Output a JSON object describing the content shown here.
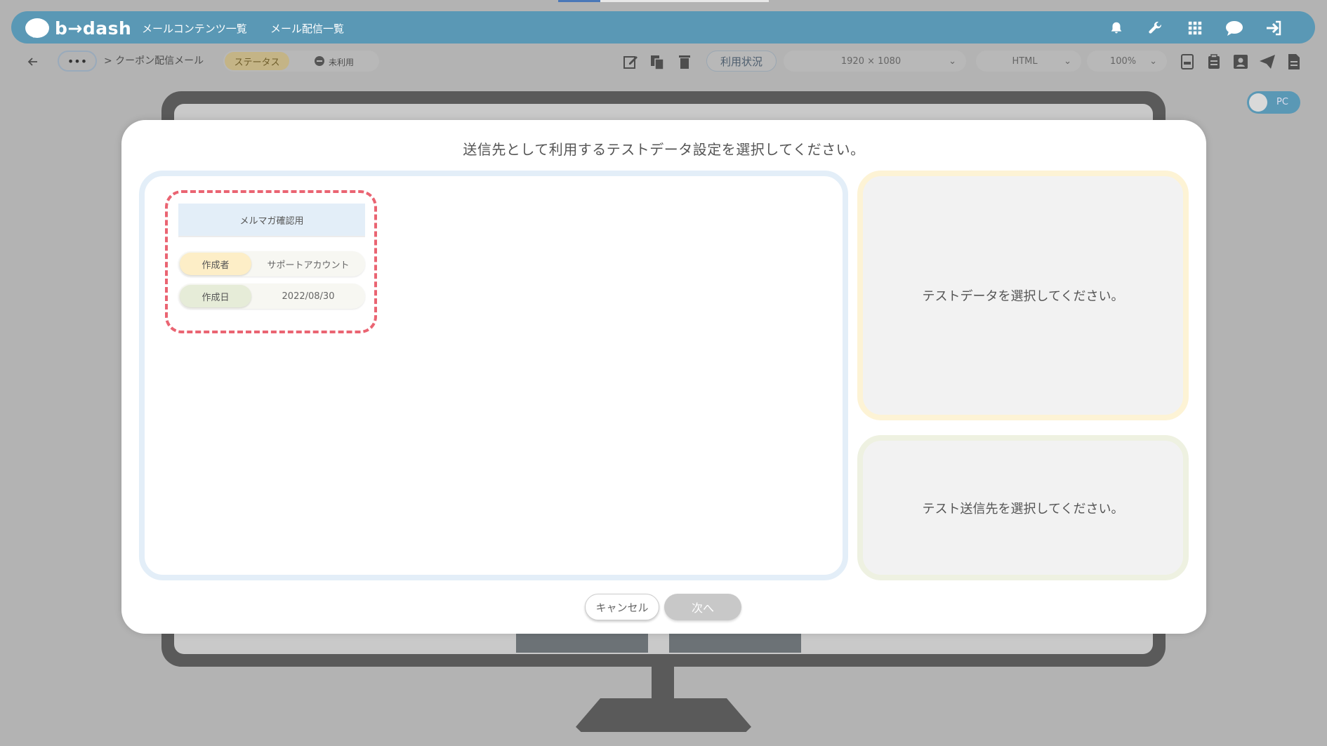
{
  "header": {
    "logo_text": "b→dash",
    "nav": [
      "メールコンテンツ一覧",
      "メール配信一覧"
    ],
    "icons": [
      "bell-icon",
      "wrench-icon",
      "grid-icon",
      "chat-icon",
      "logout-icon"
    ]
  },
  "toolbar": {
    "breadcrumb": "> クーポン配信メール",
    "status_label": "ステータス",
    "status_value": "未利用",
    "usage_button": "利用状況",
    "resolution": "1920 × 1080",
    "format": "HTML",
    "zoom": "100%"
  },
  "device_toggle": "PC",
  "modal": {
    "title": "送信先として利用するテストデータ設定を選択してください。",
    "card": {
      "title": "メルマガ確認用",
      "creator_label": "作成者",
      "creator_value": "サポートアカウント",
      "date_label": "作成日",
      "date_value": "2022/08/30"
    },
    "data_placeholder": "テストデータを選択してください。",
    "dest_placeholder": "テスト送信先を選択してください。",
    "cancel_label": "キャンセル",
    "next_label": "次へ"
  },
  "colors": {
    "header_bg": "#5a98b5",
    "highlight_dash": "#ea6472",
    "creator_label_bg": "#fdeec7",
    "date_label_bg": "#e6ecd8"
  }
}
